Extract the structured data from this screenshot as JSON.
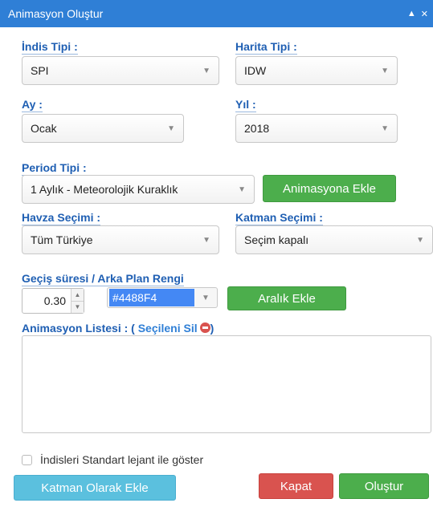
{
  "window": {
    "title": "Animasyon Oluştur",
    "collapse_glyph": "▲",
    "close_glyph": "✕"
  },
  "fields": {
    "indis_tipi": {
      "label": "İndis Tipi :",
      "value": "SPI"
    },
    "harita_tipi": {
      "label": "Harita Tipi :",
      "value": "IDW"
    },
    "ay": {
      "label": "Ay :",
      "value": "Ocak"
    },
    "yil": {
      "label": "Yıl :",
      "value": "2018"
    },
    "period_tipi": {
      "label": "Period Tipi :",
      "value": "1 Aylık - Meteorolojik Kuraklık"
    },
    "havza_secimi": {
      "label": "Havza Seçimi :",
      "value": "Tüm Türkiye"
    },
    "katman_secimi": {
      "label": "Katman Seçimi :",
      "value": "Seçim kapalı"
    },
    "gecis": {
      "label": "Geçiş süresi / Arka Plan Rengi",
      "duration": "0.30",
      "color_hex": "#4488F4"
    }
  },
  "buttons": {
    "animasyona_ekle": "Animasyona Ekle",
    "aralik_ekle": "Aralık Ekle",
    "katman_olarak_ekle": "Katman Olarak Ekle",
    "kapat": "Kapat",
    "olustur": "Oluştur"
  },
  "list": {
    "title_prefix": "Animasyon Listesi : (",
    "delete_link": "Seçileni Sil",
    "title_suffix": ")"
  },
  "checkbox": {
    "label": "İndisleri Standart lejant ile göster",
    "checked": false
  },
  "colors": {
    "titlebar": "#2f7fd6",
    "label": "#1f5fb3",
    "green": "#4cae4c",
    "red": "#d9534f",
    "light_blue": "#5bc0de"
  }
}
